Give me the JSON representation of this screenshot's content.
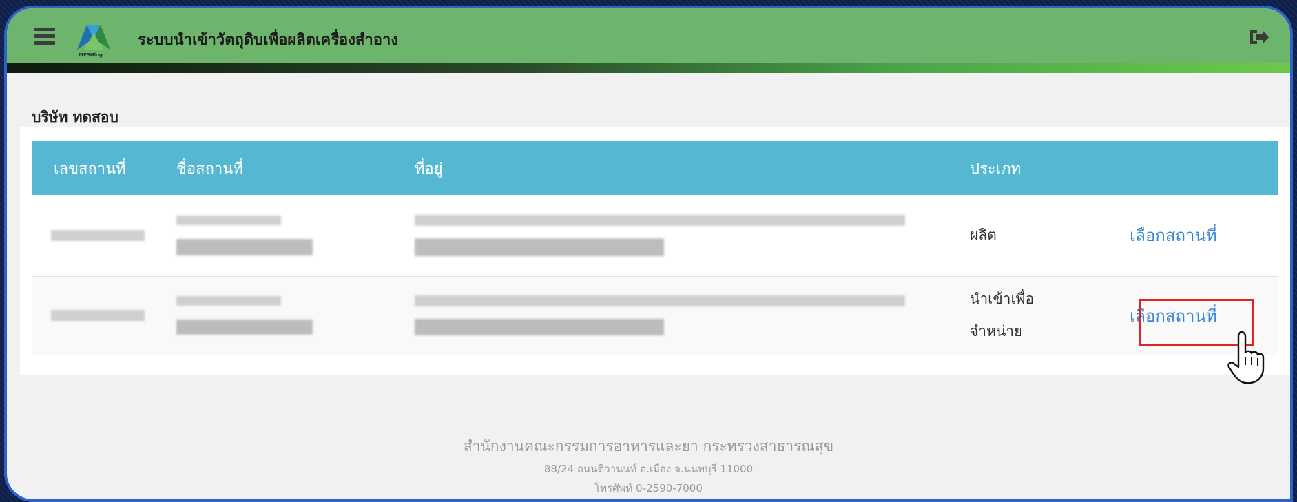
{
  "header": {
    "app_title": "ระบบนำเข้าวัตถุดิบเพื่อผลิตเครื่องสำอาง",
    "logo_text": "MESHlog",
    "menu_icon": "hamburger-menu-icon",
    "logout_icon": "sign-out-icon"
  },
  "company": {
    "name": "บริษัท ทดสอบ"
  },
  "table": {
    "columns": [
      "เลขสถานที่",
      "ชื่อสถานที่",
      "ที่อยู่",
      "ประเภท",
      ""
    ],
    "rows": [
      {
        "type": "ผลิต",
        "action": "เลือกสถานที่"
      },
      {
        "type_line1": "นำเข้าเพื่อ",
        "type_line2": "จำหน่าย",
        "action": "เลือกสถานที่"
      }
    ]
  },
  "footer": {
    "line1": "สำนักงานคณะกรรมการอาหารและยา กระทรวงสาธารณสุข",
    "line2": "88/24 ถนนติวานนท์ อ.เมือง จ.นนทบุรี 11000",
    "line3": "โทรศัพท์ 0-2590-7000"
  },
  "colors": {
    "header_bg": "#6db56d",
    "table_header_bg": "#55b7d1",
    "link": "#3a86d6",
    "highlight": "#e02323",
    "frame_border": "#2f62c6"
  }
}
